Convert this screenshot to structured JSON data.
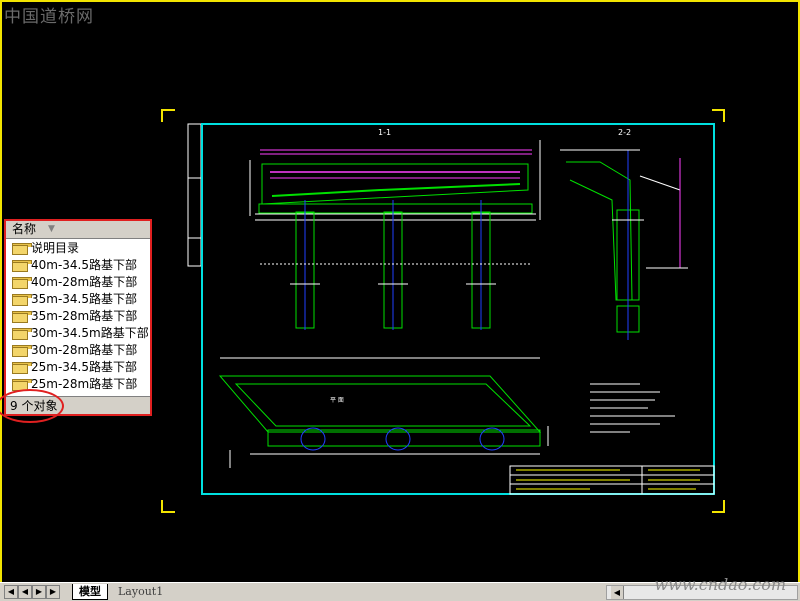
{
  "watermark_top": "中国道桥网",
  "watermark_bottom": "www.cndao.com",
  "folder_panel": {
    "column_header": "名称",
    "items": [
      {
        "label": "说明目录"
      },
      {
        "label": "40m-34.5路基下部"
      },
      {
        "label": "40m-28m路基下部"
      },
      {
        "label": "35m-34.5路基下部"
      },
      {
        "label": "35m-28m路基下部"
      },
      {
        "label": "30m-34.5m路基下部"
      },
      {
        "label": "30m-28m路基下部"
      },
      {
        "label": "25m-34.5路基下部"
      },
      {
        "label": "25m-28m路基下部"
      }
    ],
    "status": "9 个对象"
  },
  "drawing": {
    "section_a": "1-1",
    "section_b": "2-2",
    "plan_label": "平 面"
  },
  "tabs": {
    "model": "模型",
    "layout1": "Layout1"
  },
  "colors": {
    "background": "#000000",
    "frame": "#f2e400",
    "sheet_border": "#00e0e0",
    "structure": "#00e000",
    "dimension": "#ff40ff",
    "text": "#ffffff",
    "highlight": "#e02020"
  }
}
